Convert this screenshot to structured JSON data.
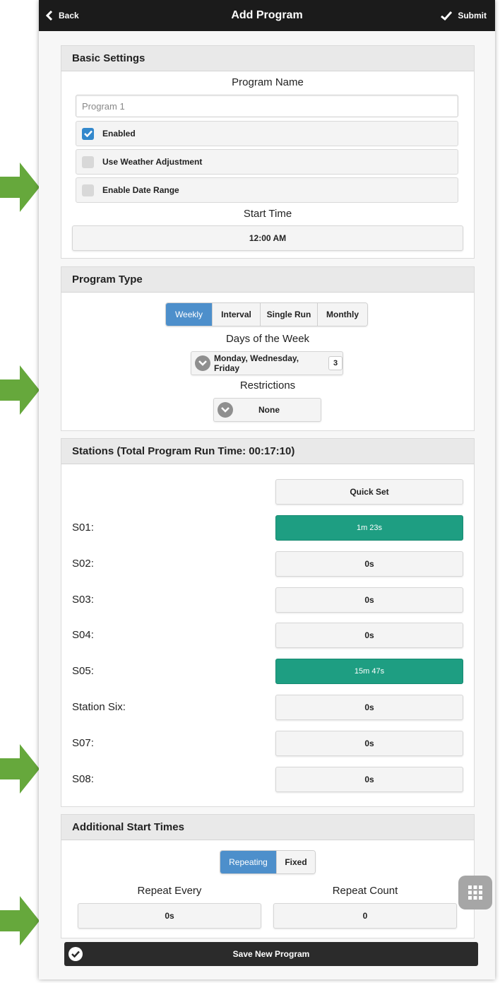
{
  "header": {
    "back_label": "Back",
    "title": "Add Program",
    "submit_label": "Submit"
  },
  "basic_settings": {
    "title": "Basic Settings",
    "program_name_label": "Program Name",
    "program_name_placeholder": "Program 1",
    "enabled_label": "Enabled",
    "enabled_checked": true,
    "weather_label": "Use Weather Adjustment",
    "weather_checked": false,
    "date_range_label": "Enable Date Range",
    "date_range_checked": false,
    "start_time_label": "Start Time",
    "start_time_value": "12:00 AM"
  },
  "program_type": {
    "title": "Program Type",
    "tabs": [
      {
        "label": "Weekly",
        "active": true
      },
      {
        "label": "Interval",
        "active": false
      },
      {
        "label": "Single Run",
        "active": false
      },
      {
        "label": "Monthly",
        "active": false
      }
    ],
    "days_label": "Days of the Week",
    "days_value": "Monday, Wednesday, Friday",
    "days_count": "3",
    "restrictions_label": "Restrictions",
    "restrictions_value": "None"
  },
  "stations": {
    "title": "Stations (Total Program Run Time: 00:17:10)",
    "quick_set_label": "Quick Set",
    "items": [
      {
        "name": "S01:",
        "duration": "1m 23s",
        "active": true
      },
      {
        "name": "S02:",
        "duration": "0s",
        "active": false
      },
      {
        "name": "S03:",
        "duration": "0s",
        "active": false
      },
      {
        "name": "S04:",
        "duration": "0s",
        "active": false
      },
      {
        "name": "S05:",
        "duration": "15m 47s",
        "active": true
      },
      {
        "name": "Station Six:",
        "duration": "0s",
        "active": false
      },
      {
        "name": "S07:",
        "duration": "0s",
        "active": false
      },
      {
        "name": "S08:",
        "duration": "0s",
        "active": false
      }
    ]
  },
  "additional_start_times": {
    "title": "Additional Start Times",
    "tabs": [
      {
        "label": "Repeating",
        "active": true
      },
      {
        "label": "Fixed",
        "active": false
      }
    ],
    "repeat_every_label": "Repeat Every",
    "repeat_every_value": "0s",
    "repeat_count_label": "Repeat Count",
    "repeat_count_value": "0"
  },
  "save_label": "Save New Program",
  "colors": {
    "accent_blue": "#4d8fcb",
    "active_green": "#1e9e82",
    "arrow_green": "#66a83c",
    "header_dark": "#1b1b1b"
  },
  "icons": {
    "back": "chevron-left-icon",
    "submit": "check-icon",
    "dropdown": "chevron-down-icon",
    "save": "check-icon",
    "grid": "grid-menu-icon",
    "annotation": "arrow-right-icon"
  }
}
